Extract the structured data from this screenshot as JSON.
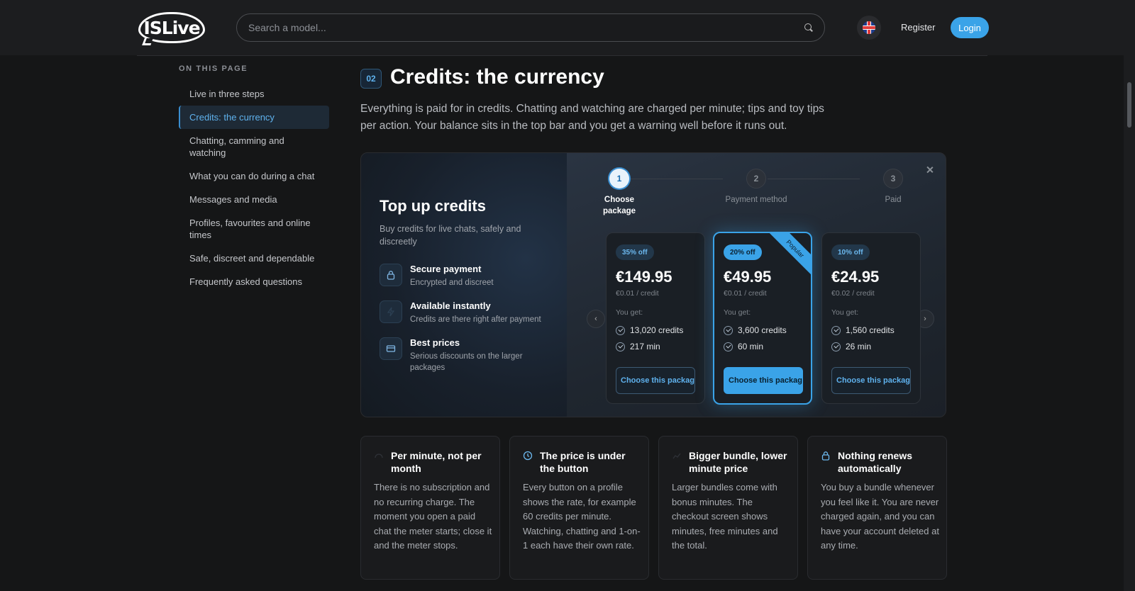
{
  "header": {
    "logo_text": "ISLive",
    "search_placeholder": "Search a model...",
    "register": "Register",
    "login": "Login"
  },
  "toc": {
    "heading": "ON THIS PAGE",
    "items": [
      "Live in three steps",
      "Credits: the currency",
      "Chatting, camming and watching",
      "What you can do during a chat",
      "Messages and media",
      "Profiles, favourites and online times",
      "Safe, discreet and dependable",
      "Frequently asked questions"
    ],
    "active_index": 1
  },
  "section": {
    "number": "02",
    "title": "Credits: the currency",
    "intro": "Everything is paid for in credits. Chatting and watching are charged per minute; tips and toy tips per action. Your balance sits in the top bar and you get a warning well before it runs out."
  },
  "widget": {
    "title": "Top up credits",
    "subtitle": "Buy credits for live chats, safely and discreetly",
    "features": [
      {
        "icon": "lock-icon",
        "title": "Secure payment",
        "desc": "Encrypted and discreet"
      },
      {
        "icon": "bolt-icon",
        "title": "Available instantly",
        "desc": "Credits are there right after payment"
      },
      {
        "icon": "card-icon",
        "title": "Best prices",
        "desc": "Serious discounts on the larger packages"
      }
    ],
    "steps": [
      {
        "num": "1",
        "label": "Choose package",
        "active": true
      },
      {
        "num": "2",
        "label": "Payment method",
        "active": false
      },
      {
        "num": "3",
        "label": "Paid",
        "active": false
      }
    ],
    "packages": [
      {
        "off": "35% off",
        "price": "€149.95",
        "per": "€0.01 / credit",
        "get": "You get:",
        "credits": "13,020 credits",
        "minutes": "217 min",
        "button": "Choose this package",
        "popular": false
      },
      {
        "off": "20% off",
        "price": "€49.95",
        "per": "€0.01 / credit",
        "get": "You get:",
        "credits": "3,600 credits",
        "minutes": "60 min",
        "button": "Choose this package",
        "popular": true,
        "ribbon": "Popular"
      },
      {
        "off": "10% off",
        "price": "€24.95",
        "per": "€0.02 / credit",
        "get": "You get:",
        "credits": "1,560 credits",
        "minutes": "26 min",
        "button": "Choose this package",
        "popular": false
      }
    ],
    "prev_arrow": "‹",
    "next_arrow": "›"
  },
  "cards": [
    {
      "icon": "meter-icon",
      "title": "Per minute, not per month",
      "body": "There is no subscription and no recurring charge. The moment you open a paid chat the meter starts; close it and the meter stops."
    },
    {
      "icon": "clock-icon",
      "title": "The price is under the button",
      "body": "Every button on a profile shows the rate, for example 60 credits per minute. Watching, chatting and 1-on-1 each have their own rate."
    },
    {
      "icon": "chart-icon",
      "title": "Bigger bundle, lower minute price",
      "body": "Larger bundles come with bonus minutes. The checkout screen shows minutes, free minutes and the total."
    },
    {
      "icon": "lock-icon",
      "title": "Nothing renews automatically",
      "body": "You buy a bundle whenever you feel like it. You are never charged again, and you can have your account deleted at any time."
    }
  ],
  "colors": {
    "accent": "#3aa3e8",
    "background": "#151617",
    "header": "#1c1d1f"
  }
}
